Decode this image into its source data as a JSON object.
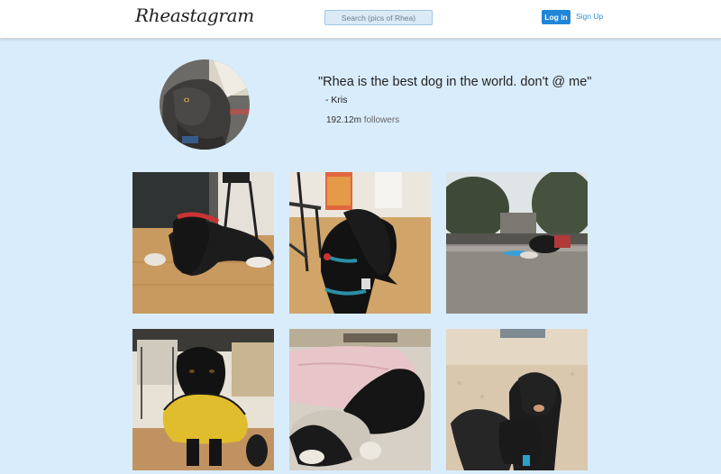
{
  "header": {
    "logo": "Rheastagram",
    "search_placeholder": "Search (pics of Rhea)",
    "login_label": "Log in",
    "signup_label": "Sign Up"
  },
  "profile": {
    "quote": "\"Rhea is the best dog in the world. don't @ me\"",
    "author": "- Kris",
    "followers_count": "192.12m",
    "followers_label": "followers"
  },
  "photos": [
    {
      "subject": "black dog lying on wood floor by couch and stool"
    },
    {
      "subject": "black dog with blue harness under chair"
    },
    {
      "subject": "dog lying on rooftop outdoors"
    },
    {
      "subject": "black dog wearing yellow raincoat"
    },
    {
      "subject": "black dog curled under pink blanket"
    },
    {
      "subject": "two dogs outdoors on gravel"
    }
  ],
  "colors": {
    "page_bg": "#d9ecfb",
    "accent": "#2185d8",
    "link": "#2e8ede"
  }
}
